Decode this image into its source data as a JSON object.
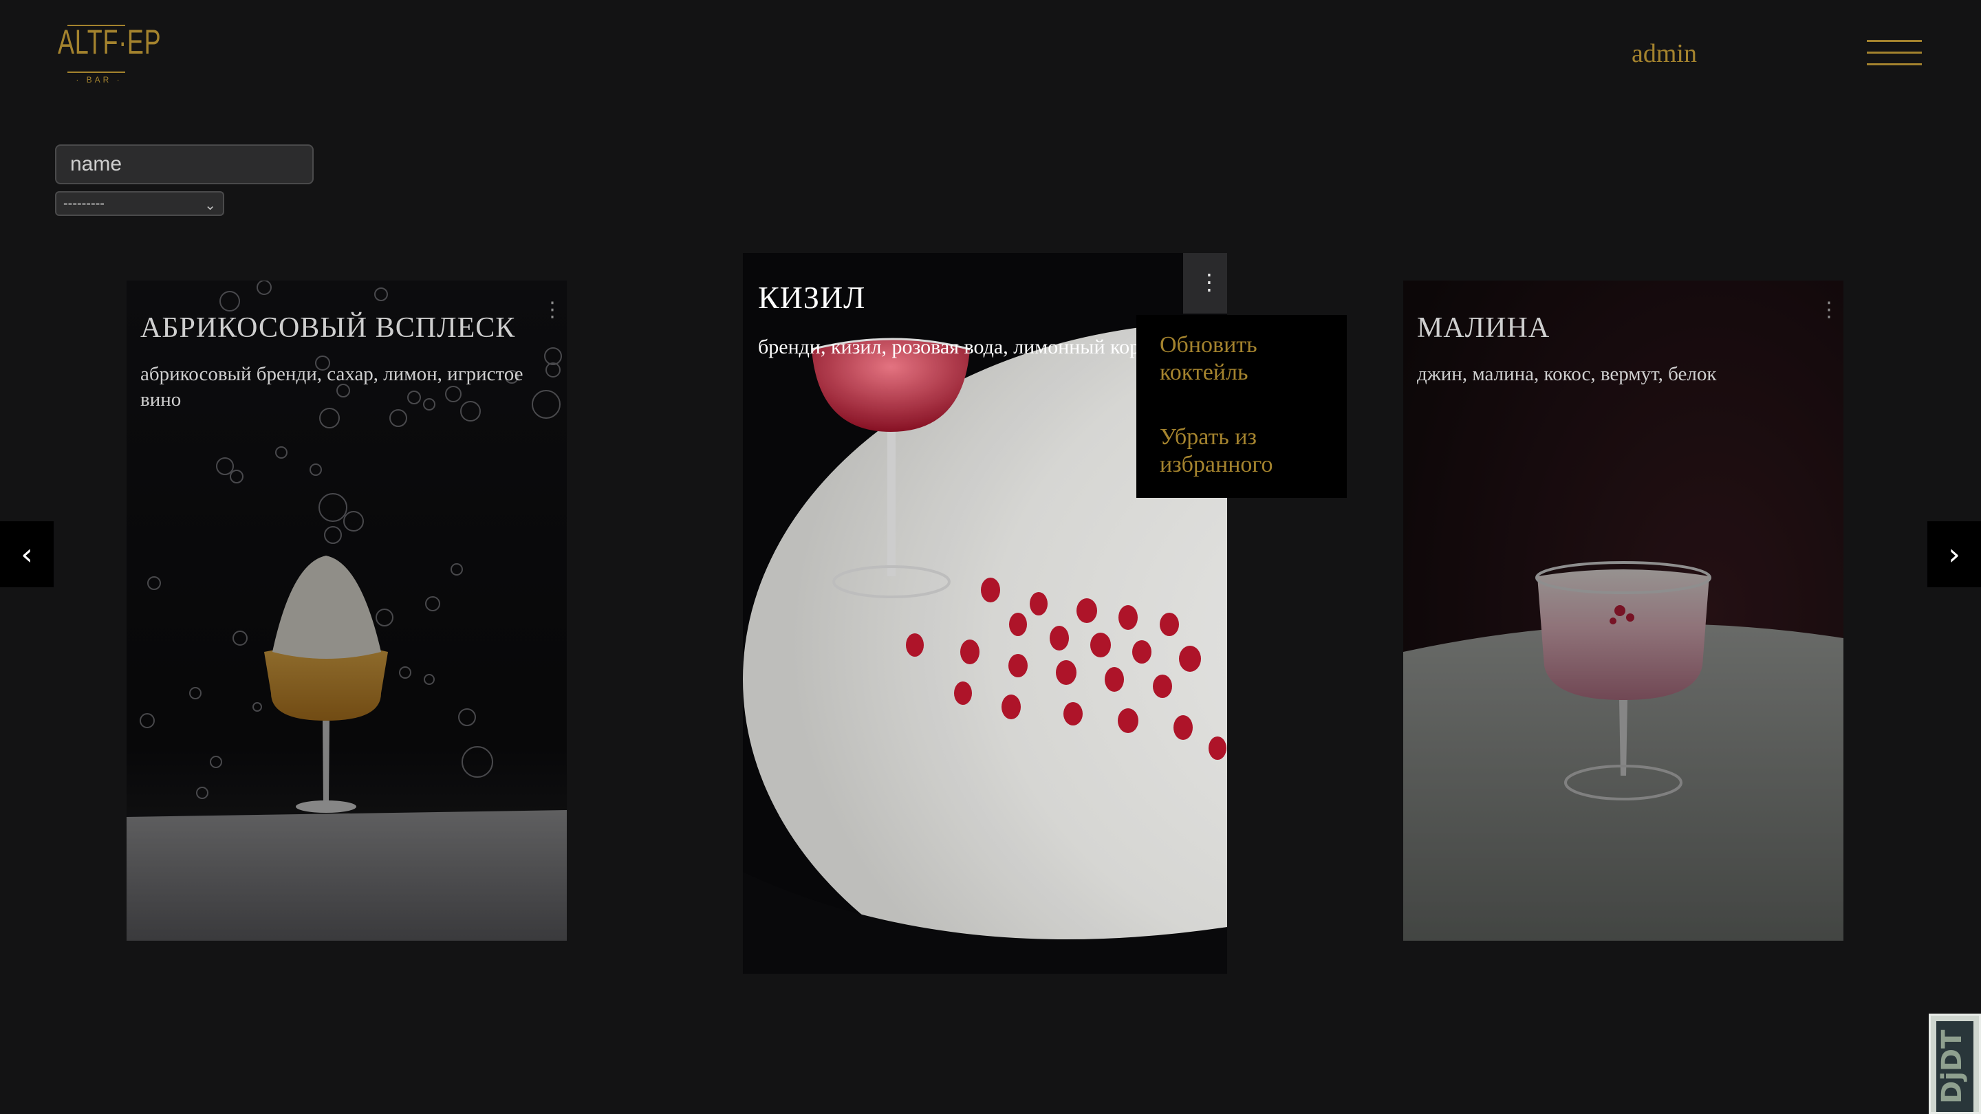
{
  "header": {
    "logo_text": "ALTF·EP",
    "logo_sub": "· BAR ·",
    "user_name": "admin"
  },
  "filters": {
    "search_placeholder": "name",
    "select_value": "---------"
  },
  "cards": [
    {
      "title": "АБРИКОСОВЫЙ ВСПЛЕСК",
      "ingredients": "абрикосовый бренди, сахар, лимон, игристое вино"
    },
    {
      "title": "КИЗИЛ",
      "ingredients": "бренди, кизил, розовая вода, лимонный кордиал"
    },
    {
      "title": "МАЛИНА",
      "ingredients": "джин, малина, кокос, вермут, белок"
    }
  ],
  "menu": {
    "update": "Обновить коктейль",
    "remove_favorite": "Убрать из избранного"
  },
  "carousel": {
    "prev": "‹",
    "next": "›"
  },
  "debug_toolbar": "DjDT",
  "icons": {
    "kebab": "⋮"
  },
  "colors": {
    "background": "#131314",
    "accent_gold": "#a4832e",
    "dropdown_bg": "#000000"
  }
}
